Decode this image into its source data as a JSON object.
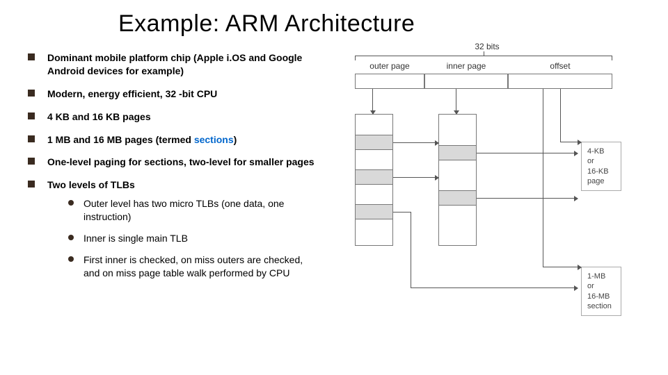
{
  "title": "Example: ARM Architecture",
  "bullets": {
    "b1": "Dominant mobile platform chip (Apple i.OS and Google Android devices for example)",
    "b2": "Modern, energy efficient, 32 -bit CPU",
    "b3": "4 KB and 16 KB pages",
    "b4_pre": "1 MB and 16 MB pages (termed ",
    "b4_hl": "sections",
    "b4_post": ")",
    "b5": "One-level paging for sections, two-level for smaller pages",
    "b6": "Two levels of TLBs",
    "s1": "Outer level has two micro TLBs (one data, one instruction)",
    "s2": "Inner is single main TLB",
    "s3": "First inner is checked, on miss outers are checked, and on miss page table walk performed by CPU"
  },
  "diagram": {
    "bits_label": "32 bits",
    "outer_page": "outer page",
    "inner_page": "inner page",
    "offset": "offset",
    "page_label": "4-KB\nor\n16-KB\npage",
    "section_label": "1-MB\nor\n16-MB\nsection"
  }
}
